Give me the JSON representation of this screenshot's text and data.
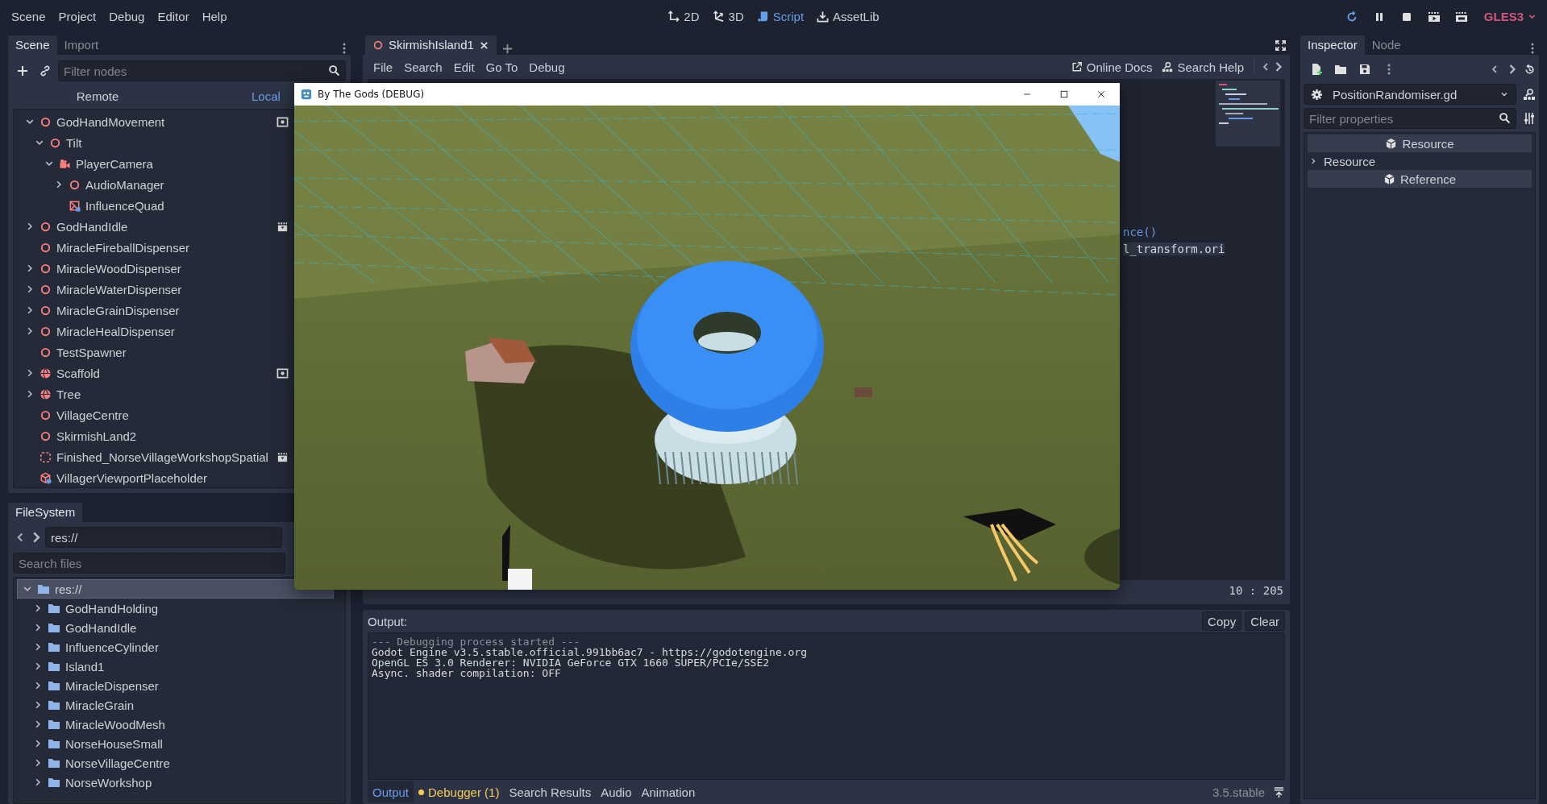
{
  "menu_bar": {
    "menus": [
      "Scene",
      "Project",
      "Debug",
      "Editor",
      "Help"
    ],
    "workspaces": [
      {
        "label": "2D",
        "kind": "canvas",
        "selected": false
      },
      {
        "label": "3D",
        "kind": "spatial",
        "selected": false
      },
      {
        "label": "Script",
        "kind": "script",
        "selected": true
      },
      {
        "label": "AssetLib",
        "kind": "assetlib",
        "selected": false
      }
    ],
    "renderer": "GLES3"
  },
  "scene_dock": {
    "tabs": [
      {
        "label": "Scene",
        "selected": true
      },
      {
        "label": "Import",
        "selected": false
      }
    ],
    "filter_placeholder": "Filter nodes",
    "view_modes": [
      {
        "label": "Remote",
        "selected": false
      },
      {
        "label": "Local",
        "selected": true
      }
    ],
    "tree": [
      {
        "name": "GodHandMovement",
        "kind": "node3d",
        "has_children": true,
        "expanded": true,
        "badges": [
          {
            "kind": "square-dot"
          }
        ],
        "children": [
          {
            "name": "Tilt",
            "kind": "node3d",
            "has_children": true,
            "expanded": true,
            "children": [
              {
                "name": "PlayerCamera",
                "kind": "camera",
                "has_children": true,
                "expanded": true,
                "children": [
                  {
                    "name": "AudioManager",
                    "kind": "node3d",
                    "has_children": true,
                    "expanded": false
                  },
                  {
                    "name": "InfluenceQuad",
                    "kind": "mesh",
                    "has_children": false,
                    "expanded": false
                  }
                ]
              }
            ]
          }
        ]
      },
      {
        "name": "GodHandIdle",
        "kind": "node3d",
        "has_children": true,
        "expanded": false,
        "badges": [
          {
            "kind": "clapper"
          }
        ]
      },
      {
        "name": "MiracleFireballDispenser",
        "kind": "node3d",
        "has_children": false,
        "expanded": false
      },
      {
        "name": "MiracleWoodDispenser",
        "kind": "node3d",
        "has_children": true,
        "expanded": false
      },
      {
        "name": "MiracleWaterDispenser",
        "kind": "node3d",
        "has_children": true,
        "expanded": false
      },
      {
        "name": "MiracleGrainDispenser",
        "kind": "node3d",
        "has_children": true,
        "expanded": false
      },
      {
        "name": "MiracleHealDispenser",
        "kind": "node3d",
        "has_children": true,
        "expanded": false
      },
      {
        "name": "TestSpawner",
        "kind": "node3d",
        "has_children": false,
        "expanded": false
      },
      {
        "name": "Scaffold",
        "kind": "globe",
        "has_children": true,
        "expanded": false,
        "badges": [
          {
            "kind": "square-dot"
          }
        ]
      },
      {
        "name": "Tree",
        "kind": "globe",
        "has_children": true,
        "expanded": false
      },
      {
        "name": "VillageCentre",
        "kind": "node3d",
        "has_children": false,
        "expanded": false
      },
      {
        "name": "SkirmishLand2",
        "kind": "node3d",
        "has_children": false,
        "expanded": false
      },
      {
        "name": "Finished_NorseVillageWorkshopSpatial",
        "kind": "dashed-box",
        "has_children": false,
        "expanded": false,
        "badges": [
          {
            "kind": "clapper"
          }
        ]
      },
      {
        "name": "VillagerViewportPlaceholder",
        "kind": "cube",
        "has_children": false,
        "expanded": false
      }
    ]
  },
  "filesystem_dock": {
    "tabs": [
      {
        "label": "FileSystem",
        "selected": true
      }
    ],
    "path": "res://",
    "search_placeholder": "Search files",
    "tree": [
      {
        "name": "res://",
        "selected": true,
        "has_children": true,
        "expanded": true,
        "children": [
          {
            "name": "GodHandHolding",
            "selected": false,
            "has_children": true,
            "expanded": false
          },
          {
            "name": "GodHandIdle",
            "selected": false,
            "has_children": true,
            "expanded": false
          },
          {
            "name": "InfluenceCylinder",
            "selected": false,
            "has_children": true,
            "expanded": false
          },
          {
            "name": "Island1",
            "selected": false,
            "has_children": true,
            "expanded": false
          },
          {
            "name": "MiracleDispenser",
            "selected": false,
            "has_children": true,
            "expanded": false
          },
          {
            "name": "MiracleGrain",
            "selected": false,
            "has_children": true,
            "expanded": false
          },
          {
            "name": "MiracleWoodMesh",
            "selected": false,
            "has_children": true,
            "expanded": false
          },
          {
            "name": "NorseHouseSmall",
            "selected": false,
            "has_children": true,
            "expanded": false
          },
          {
            "name": "NorseVillageCentre",
            "selected": false,
            "has_children": true,
            "expanded": false
          },
          {
            "name": "NorseWorkshop",
            "selected": false,
            "has_children": true,
            "expanded": false
          }
        ]
      }
    ]
  },
  "script_editor": {
    "tabs": [
      {
        "label": "SkirmishIsland1",
        "selected": true
      }
    ],
    "menus": [
      "File",
      "Search",
      "Edit",
      "Go To",
      "Debug"
    ],
    "help_links": [
      {
        "label": "Online Docs",
        "kind": "external"
      },
      {
        "label": "Search Help",
        "kind": "doc"
      }
    ],
    "code_fragments": [
      {
        "text": "nce()",
        "kind": "call"
      },
      {
        "text": "l_transform.ori",
        "kind": "highlighted"
      }
    ],
    "cursor_position": "10 : 205"
  },
  "output_panel": {
    "title": "Output:",
    "buttons": [
      "Copy",
      "Clear"
    ],
    "lines": [
      {
        "text": "--- Debugging process started ---",
        "kind": "info"
      },
      {
        "text": "Godot Engine v3.5.stable.official.991bb6ac7 - https://godotengine.org",
        "kind": "plain"
      },
      {
        "text": "OpenGL ES 3.0 Renderer: NVIDIA GeForce GTX 1660 SUPER/PCIe/SSE2",
        "kind": "plain"
      },
      {
        "text": "Async. shader compilation: OFF",
        "kind": "plain"
      }
    ],
    "tabs": [
      {
        "label": "Output",
        "selected": true,
        "alert": false
      },
      {
        "label": "Debugger (1)",
        "selected": false,
        "alert": true
      },
      {
        "label": "Search Results",
        "selected": false,
        "alert": false
      },
      {
        "label": "Audio",
        "selected": false,
        "alert": false
      },
      {
        "label": "Animation",
        "selected": false,
        "alert": false
      }
    ],
    "version": "3.5.stable"
  },
  "inspector": {
    "tabs": [
      {
        "label": "Inspector",
        "selected": true
      },
      {
        "label": "Node",
        "selected": false
      }
    ],
    "resource": "PositionRandomiser.gd",
    "filter_placeholder": "Filter properties",
    "sections": [
      {
        "kind": "category",
        "label": "Resource"
      },
      {
        "kind": "group",
        "label": "Resource",
        "expanded": false
      },
      {
        "kind": "category",
        "label": "Reference"
      }
    ]
  },
  "debug_window": {
    "title": "By The Gods (DEBUG)"
  }
}
